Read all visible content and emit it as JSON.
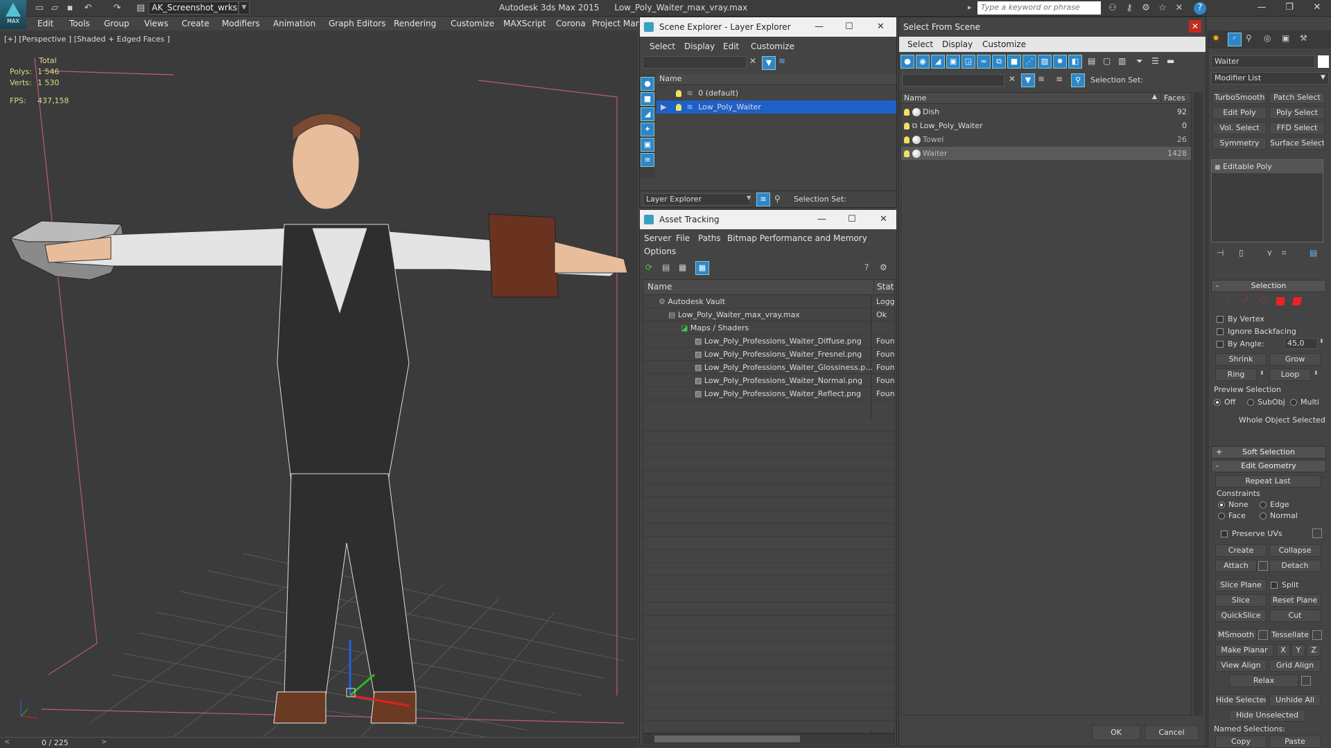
{
  "app": {
    "logo_label": "MAX",
    "workspace": "AK_Screenshot_wrksp",
    "title_app": "Autodesk 3ds Max  2015",
    "title_file": "Low_Poly_Waiter_max_vray.max",
    "search_placeholder": "Type a keyword or phrase"
  },
  "menu": [
    "Edit",
    "Tools",
    "Group",
    "Views",
    "Create",
    "Modifiers",
    "Animation",
    "Graph Editors",
    "Rendering",
    "Customize",
    "MAXScript",
    "Corona",
    "Project Man"
  ],
  "viewport": {
    "label": "[+] [Perspective ] [Shaded + Edged Faces ]",
    "stats_header": "Total",
    "polys_label": "Polys:",
    "polys_value": "1 546",
    "verts_label": "Verts:",
    "verts_value": "1 530",
    "fps_label": "FPS:",
    "fps_value": "437,158"
  },
  "timeline": {
    "frame": "0 / 225"
  },
  "scene_explorer": {
    "title": "Scene Explorer - Layer Explorer",
    "menu": [
      "Select",
      "Display",
      "Edit",
      "Customize"
    ],
    "col_name": "Name",
    "rows": [
      "0 (default)",
      "Low_Poly_Waiter"
    ],
    "footer_dropdown": "Layer Explorer",
    "footer_selset": "Selection Set:"
  },
  "asset_tracking": {
    "title": "Asset Tracking",
    "menu": [
      "Server",
      "File",
      "Paths",
      "Bitmap Performance and Memory",
      "Options"
    ],
    "col_name": "Name",
    "col_status": "Status",
    "rows": [
      {
        "name": "Autodesk Vault",
        "status": "Logge"
      },
      {
        "name": "Low_Poly_Waiter_max_vray.max",
        "status": "Ok"
      },
      {
        "name": "Maps / Shaders",
        "status": ""
      },
      {
        "name": "Low_Poly_Professions_Waiter_Diffuse.png",
        "status": "Found"
      },
      {
        "name": "Low_Poly_Professions_Waiter_Fresnel.png",
        "status": "Found"
      },
      {
        "name": "Low_Poly_Professions_Waiter_Glossiness.p...",
        "status": "Found"
      },
      {
        "name": "Low_Poly_Professions_Waiter_Normal.png",
        "status": "Found"
      },
      {
        "name": "Low_Poly_Professions_Waiter_Reflect.png",
        "status": "Found"
      }
    ]
  },
  "select_from_scene": {
    "title": "Select From Scene",
    "menu": [
      "Select",
      "Display",
      "Customize"
    ],
    "selset": "Selection Set:",
    "col_name": "Name",
    "col_faces": "Faces",
    "rows": [
      {
        "name": "Dish",
        "faces": "92"
      },
      {
        "name": "Low_Poly_Waiter",
        "faces": "0"
      },
      {
        "name": "Towel",
        "faces": "26"
      },
      {
        "name": "Waiter",
        "faces": "1428"
      }
    ],
    "ok": "OK",
    "cancel": "Cancel"
  },
  "command_panel": {
    "object_name": "Waiter",
    "modifier_list": "Modifier List",
    "modifier_buttons": [
      "TurboSmooth",
      "Patch Select",
      "Edit Poly",
      "Poly Select",
      "Vol. Select",
      "FFD Select",
      "Symmetry",
      "Surface Select"
    ],
    "stack_item": "Editable Poly",
    "selection_rollout": "Selection",
    "by_vertex": "By Vertex",
    "ignore_backfacing": "Ignore Backfacing",
    "by_angle": "By Angle:",
    "by_angle_value": "45,0",
    "shrink": "Shrink",
    "grow": "Grow",
    "ring": "Ring",
    "loop": "Loop",
    "preview_selection": "Preview Selection",
    "preview_off": "Off",
    "preview_subobj": "SubObj",
    "preview_multi": "Multi",
    "whole_object": "Whole Object Selected",
    "soft_selection": "Soft Selection",
    "edit_geometry": "Edit Geometry",
    "repeat_last": "Repeat Last",
    "constraints": "Constraints",
    "c_none": "None",
    "c_edge": "Edge",
    "c_face": "Face",
    "c_normal": "Normal",
    "preserve_uvs": "Preserve UVs",
    "create": "Create",
    "collapse": "Collapse",
    "attach": "Attach",
    "detach": "Detach",
    "slice_plane": "Slice Plane",
    "split": "Split",
    "slice": "Slice",
    "reset_plane": "Reset Plane",
    "quickslice": "QuickSlice",
    "cut": "Cut",
    "msmooth": "MSmooth",
    "tessellate": "Tessellate",
    "make_planar": "Make Planar",
    "x": "X",
    "y": "Y",
    "z": "Z",
    "view_align": "View Align",
    "grid_align": "Grid Align",
    "relax": "Relax",
    "hide_selected": "Hide Selected",
    "unhide_all": "Unhide All",
    "hide_unselected": "Hide Unselected",
    "named_selections": "Named Selections:",
    "copy": "Copy",
    "paste": "Paste"
  },
  "colors": {
    "selection_blue": "#1f5fc8",
    "stats_yellow": "#dcdc8c",
    "grid_line": "#555555"
  }
}
